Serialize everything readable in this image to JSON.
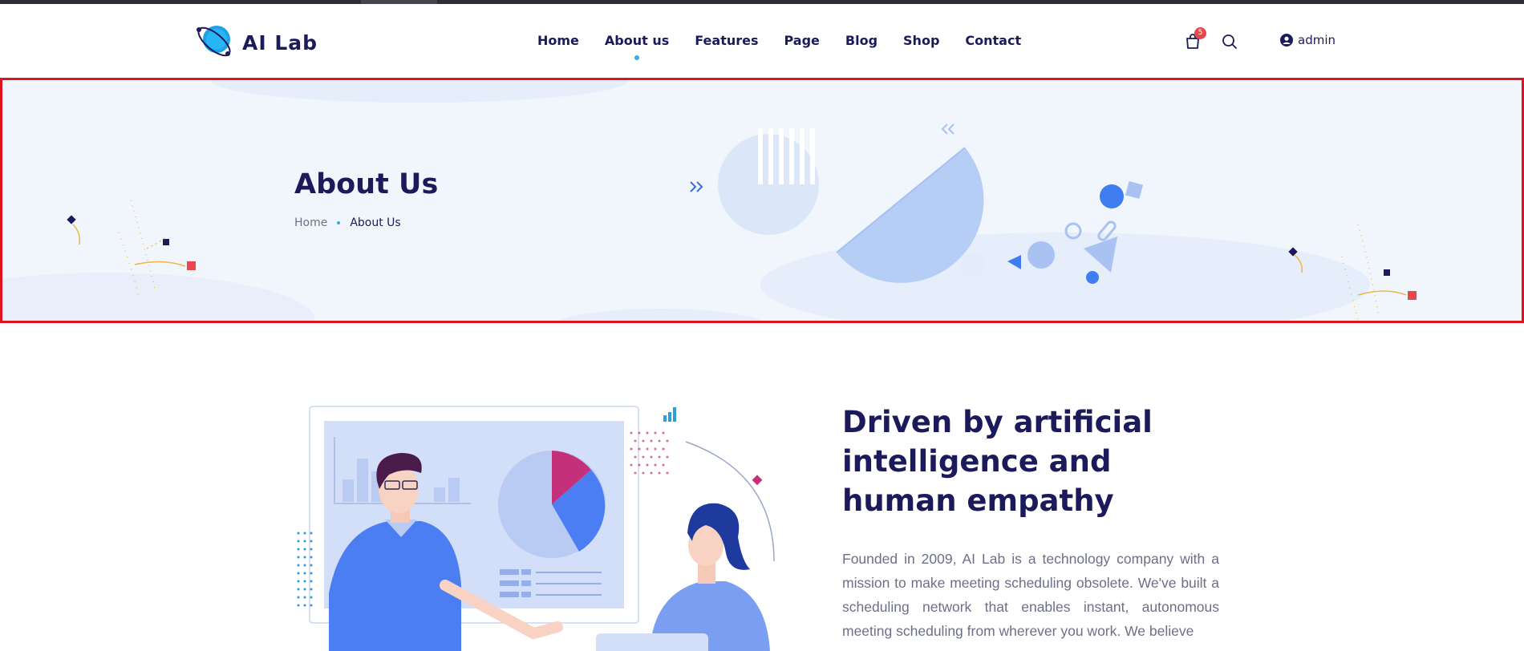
{
  "brand": {
    "name": "AI Lab",
    "logo_icon": "planet-logo-icon"
  },
  "nav": {
    "items": [
      {
        "label": "Home"
      },
      {
        "label": "About us",
        "active": true
      },
      {
        "label": "Features"
      },
      {
        "label": "Page"
      },
      {
        "label": "Blog"
      },
      {
        "label": "Shop"
      },
      {
        "label": "Contact"
      }
    ]
  },
  "header_icons": {
    "cart_icon": "shopping-bag-icon",
    "cart_count": "5",
    "search_icon": "search-icon"
  },
  "user": {
    "icon": "user-circle-icon",
    "name": "admin"
  },
  "banner": {
    "title": "About Us",
    "breadcrumb": {
      "home": "Home",
      "current": "About Us"
    }
  },
  "about": {
    "heading": "Driven by artificial intelligence and human empathy",
    "body": "Founded in 2009, AI Lab is a technology company with a mission to make meeting scheduling obsolete. We've built a scheduling network that enables instant, autonomous meeting scheduling from wherever you work. We believe"
  },
  "colors": {
    "navy": "#1b1a5a",
    "accent_blue": "#3ba6e4",
    "badge_red": "#e8474c",
    "banner_bg": "#f1f6fd",
    "highlight_border": "#e0141e"
  }
}
